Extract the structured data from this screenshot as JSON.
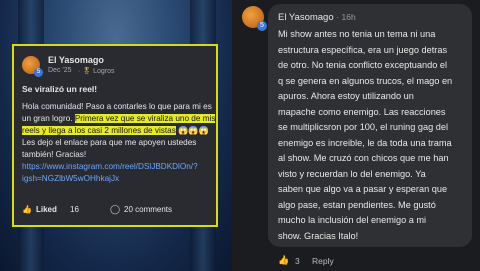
{
  "left_post": {
    "author": "El Yasomago",
    "date": "Dec '25",
    "badge": "Logros",
    "level": "5",
    "title": "Se viralizó un reel!",
    "body_plain_1": "Hola comunidad! Paso a contarles lo que para mi es",
    "body_plain_2": "un gran logro.",
    "body_highlight_1": "Primera vez que se viraliza uno de mis",
    "body_highlight_2": "reels y llega a los casi 2 millones de vistas",
    "emojis": "😱😱😱",
    "body_3": "Les dejo el enlace para que me apoyen ustedes",
    "body_4": "también! Gracias!",
    "link_1": "https://www.instagram.com/reel/DSlJBDKDlOn/?",
    "link_2": "igsh=NGZlbW5wOHhkajJx",
    "like_label": "Liked",
    "like_count": "16",
    "comments": "20 comments"
  },
  "right_comment": {
    "author": "El Yasomago",
    "time": "16h",
    "level": "5",
    "lines": [
      "Mi show antes no tenia un tema ni una",
      "estructura específica, era un juego detras",
      "de otro. No tenia conflicto exceptuando el",
      "q se genera en algunos trucos, el mago en",
      "apuros. Ahora estoy utilizando un",
      "mapache como enemigo. Las reacciones",
      "se multiplicsron por 100, el runing gag del",
      "enemigo es increible, le da toda una trama",
      "al show. Me cruzó con chicos que me han",
      "visto y recuerdan lo del enemigo. Ya",
      "saben que algo va a pasar y esperan que",
      "algo pase, estan pendientes. Me gustó",
      "mucho la inclusión del enemigo a mi",
      "show. Gracias Italo!"
    ],
    "likes": "3",
    "reply": "Reply"
  }
}
